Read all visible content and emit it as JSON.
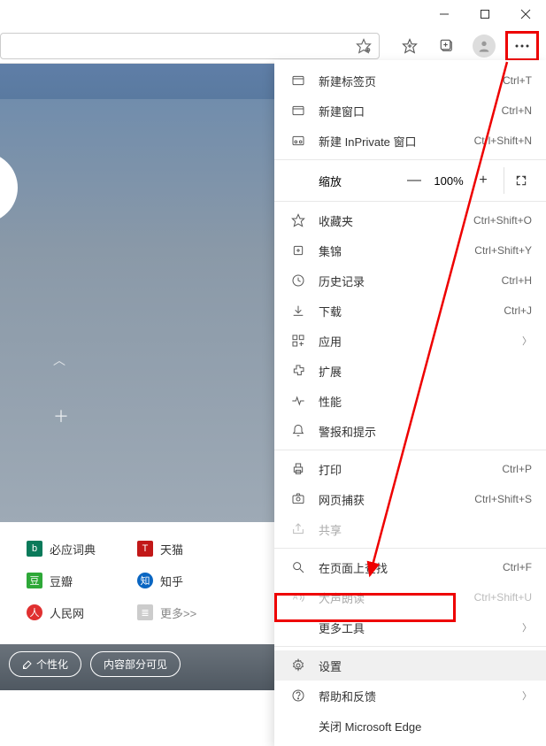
{
  "window": {
    "minimize": "—",
    "maximize": "□",
    "close": "✕"
  },
  "menu": {
    "new_tab": {
      "label": "新建标签页",
      "shortcut": "Ctrl+T"
    },
    "new_window": {
      "label": "新建窗口",
      "shortcut": "Ctrl+N"
    },
    "new_inprivate": {
      "label": "新建 InPrivate 窗口",
      "shortcut": "Ctrl+Shift+N"
    },
    "zoom": {
      "label": "缩放",
      "value": "100%"
    },
    "favorites": {
      "label": "收藏夹",
      "shortcut": "Ctrl+Shift+O"
    },
    "collections": {
      "label": "集锦",
      "shortcut": "Ctrl+Shift+Y"
    },
    "history": {
      "label": "历史记录",
      "shortcut": "Ctrl+H"
    },
    "downloads": {
      "label": "下载",
      "shortcut": "Ctrl+J"
    },
    "apps": {
      "label": "应用"
    },
    "extensions": {
      "label": "扩展"
    },
    "performance": {
      "label": "性能"
    },
    "alerts": {
      "label": "警报和提示"
    },
    "print": {
      "label": "打印",
      "shortcut": "Ctrl+P"
    },
    "capture": {
      "label": "网页捕获",
      "shortcut": "Ctrl+Shift+S"
    },
    "share": {
      "label": "共享"
    },
    "find": {
      "label": "在页面上查找",
      "shortcut": "Ctrl+F"
    },
    "read_aloud": {
      "label": "大声朗读",
      "shortcut": "Ctrl+Shift+U"
    },
    "more_tools": {
      "label": "更多工具"
    },
    "settings": {
      "label": "设置"
    },
    "help": {
      "label": "帮助和反馈"
    },
    "close_edge": {
      "label": "关闭 Microsoft Edge"
    }
  },
  "content": {
    "grid": {
      "bing_dict": "必应词典",
      "tmall": "天猫",
      "douban": "豆瓣",
      "zhihu": "知乎",
      "renmin": "人民网",
      "more": "更多>>"
    },
    "personalize": "个性化",
    "content_visible": "内容部分可见"
  }
}
